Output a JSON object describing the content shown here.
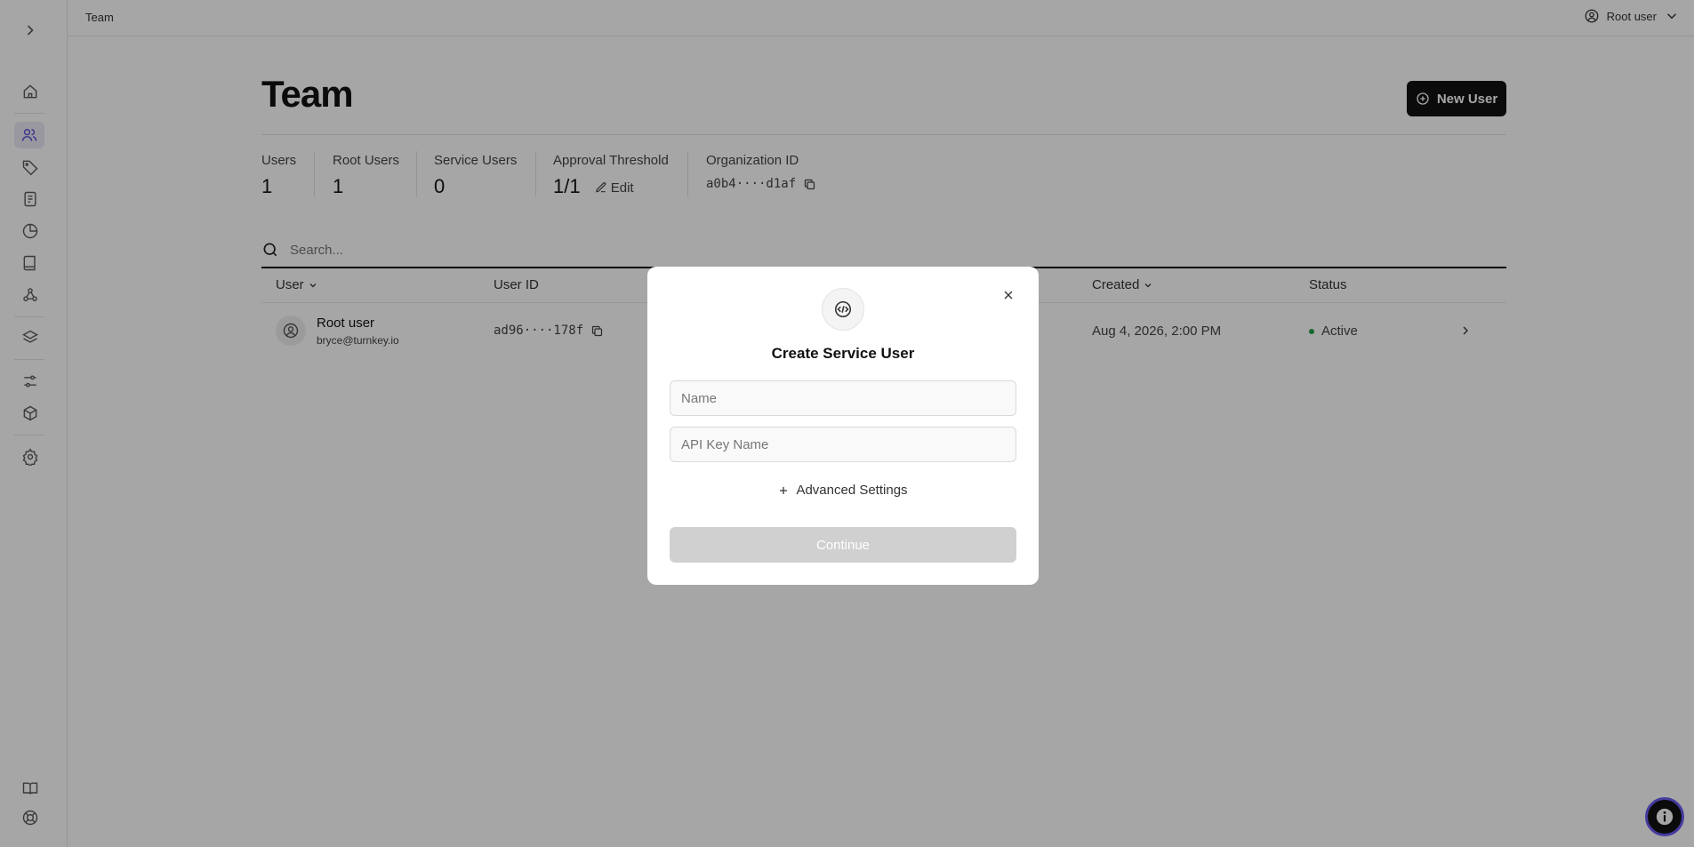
{
  "breadcrumb": "Team",
  "account": {
    "name": "Root user",
    "icon": "user-circle-icon"
  },
  "page": {
    "title": "Team",
    "new_user_label": "New User"
  },
  "stats": {
    "users": {
      "label": "Users",
      "value": "1"
    },
    "root_users": {
      "label": "Root Users",
      "value": "1"
    },
    "service_users": {
      "label": "Service Users",
      "value": "0"
    },
    "approval_threshold": {
      "label": "Approval Threshold",
      "value": "1/1",
      "edit_label": "Edit"
    },
    "organization_id": {
      "label": "Organization ID",
      "value": "a0b4····d1af"
    }
  },
  "search": {
    "placeholder": "Search..."
  },
  "table": {
    "columns": [
      "User",
      "User ID",
      "Created",
      "Status"
    ],
    "rows": [
      {
        "name": "Root user",
        "email": "bryce@turnkey.io",
        "user_id": "ad96····178f",
        "created": "Aug 4, 2026, 2:00 PM",
        "status": "Active"
      }
    ]
  },
  "modal": {
    "title": "Create Service User",
    "name_placeholder": "Name",
    "api_key_placeholder": "API Key Name",
    "advanced_label": "Advanced Settings",
    "continue_label": "Continue",
    "icon": "code-icon"
  },
  "colors": {
    "accent": "#5b4fd6",
    "status_active": "#1fa34a",
    "primary_button": "#111111"
  }
}
